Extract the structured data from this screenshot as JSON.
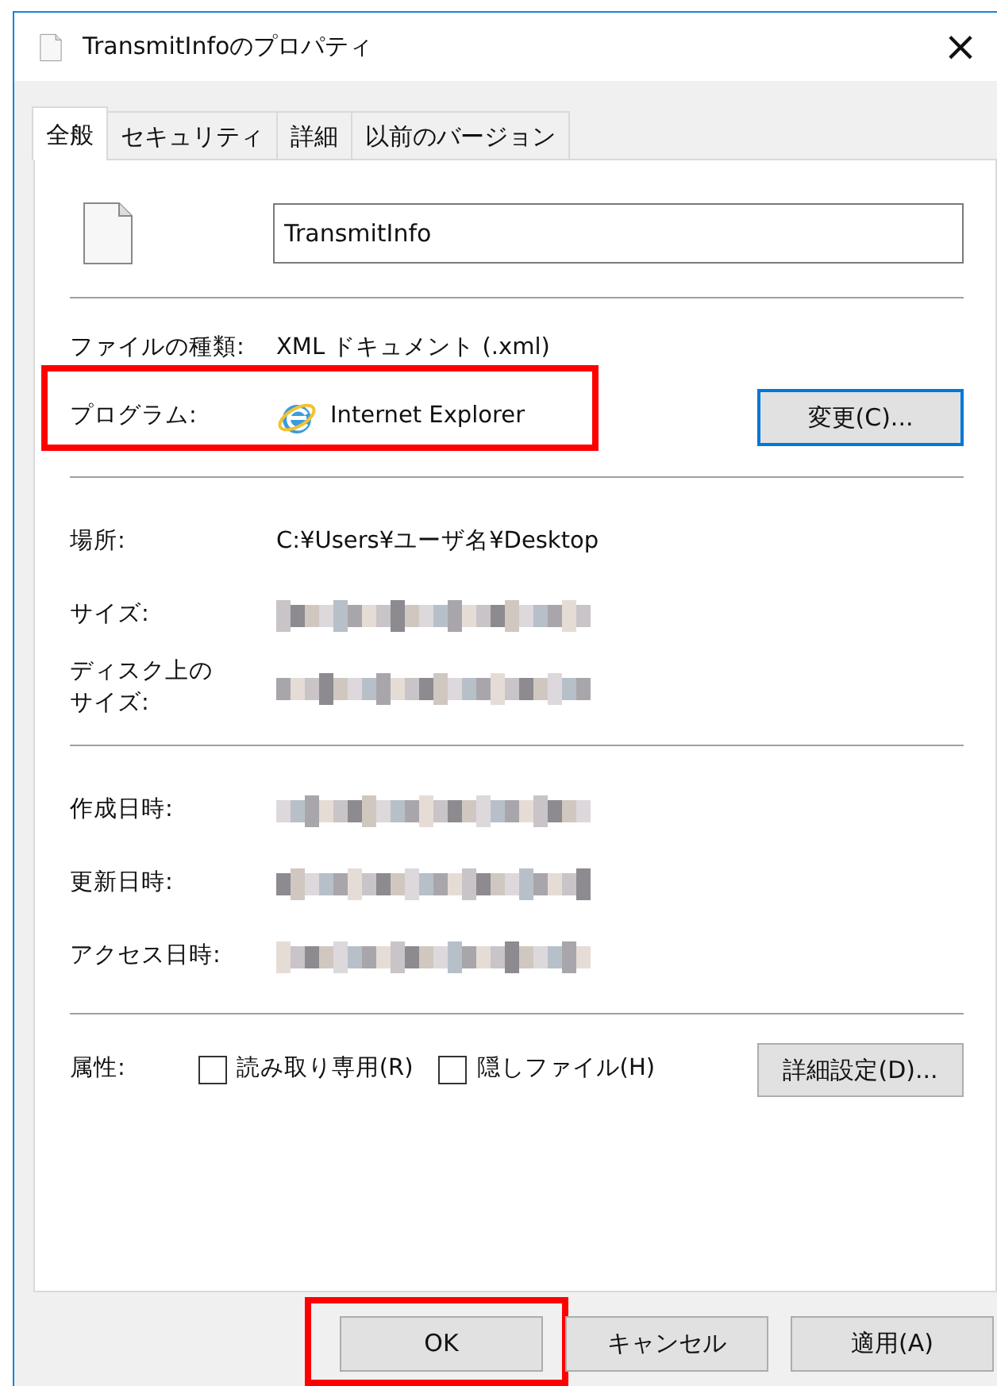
{
  "window": {
    "title": "TransmitInfoのプロパティ",
    "close": "×"
  },
  "tabs": [
    {
      "label": "全般",
      "selected": true
    },
    {
      "label": "セキュリティ",
      "selected": false
    },
    {
      "label": "詳細",
      "selected": false
    },
    {
      "label": "以前のバージョン",
      "selected": false
    }
  ],
  "file_name": {
    "value": "TransmitInfo"
  },
  "sections": [
    [
      {
        "label": "ファイルの種類:",
        "kind": "text",
        "value": "XML ドキュメント (.xml)"
      },
      {
        "label": "プログラム:",
        "kind": "program",
        "value": "Internet Explorer",
        "button": "変更(C)...",
        "highlighted": true
      }
    ],
    [
      {
        "label": "場所:",
        "kind": "text",
        "value": "C:¥Users¥ユーザ名¥Desktop"
      },
      {
        "label": "サイズ:",
        "kind": "blurred"
      },
      {
        "label": "ディスク上のサイズ:",
        "kind": "blurred"
      }
    ],
    [
      {
        "label": "作成日時:",
        "kind": "blurred"
      },
      {
        "label": "更新日時:",
        "kind": "blurred"
      },
      {
        "label": "アクセス日時:",
        "kind": "blurred"
      }
    ]
  ],
  "attributes": {
    "label": "属性:",
    "checkboxes": [
      {
        "label": "読み取り専用(R)",
        "checked": false
      },
      {
        "label": "隠しファイル(H)",
        "checked": false
      }
    ],
    "button": "詳細設定(D)..."
  },
  "buttons": [
    {
      "label": "OK",
      "highlighted": true
    },
    {
      "label": "キャンセル",
      "highlighted": false
    },
    {
      "label": "適用(A)",
      "highlighted": false
    }
  ]
}
